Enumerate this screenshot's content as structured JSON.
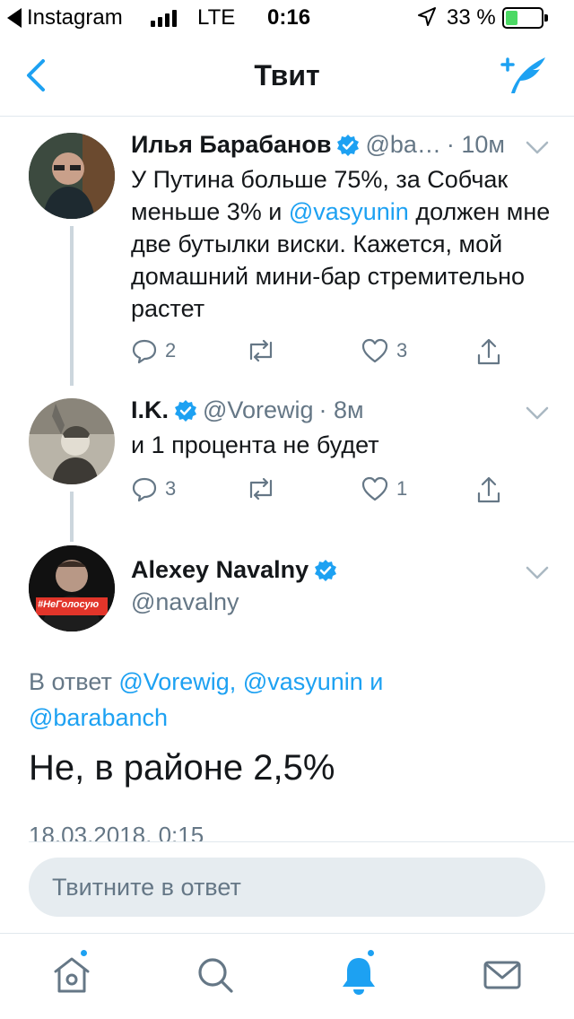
{
  "status_bar": {
    "back_app": "Instagram",
    "network": "LTE",
    "time": "0:16",
    "battery_percent": "33 %",
    "battery_level": 0.33
  },
  "nav": {
    "title": "Твит"
  },
  "tweets": [
    {
      "name": "Илья Барабанов",
      "handle": "@ba…",
      "time": "· 10м",
      "text_before": "У Путина больше 75%, за Собчак меньше 3% и ",
      "mention": "@vasyunin",
      "text_after": " должен мне две бутылки виски. Кажется, мой домашний мини-бар стремительно растет",
      "replies": "2",
      "retweets": "",
      "likes": "3"
    },
    {
      "name": "I.K.",
      "handle": "@Vorewig",
      "time": "· 8м",
      "text": "и 1 процента не будет",
      "replies": "3",
      "retweets": "",
      "likes": "1"
    }
  ],
  "main_tweet": {
    "name": "Alexey Navalny",
    "handle": "@navalny",
    "avatar_badge": "#НеГолосую",
    "reply_prefix": "В ответ ",
    "reply_mention_1": "@Vorewig,",
    "reply_mention_2": "@vasyunin",
    "reply_and": " и ",
    "reply_mention_3": "@barabanch",
    "text": "Не, в районе 2,5%",
    "date": "18.03.2018, 0:15"
  },
  "reply_box": {
    "placeholder": "Твитните в ответ"
  },
  "colors": {
    "accent": "#1da1f2",
    "secondary_text": "#657786",
    "divider": "#e1e8ed"
  }
}
